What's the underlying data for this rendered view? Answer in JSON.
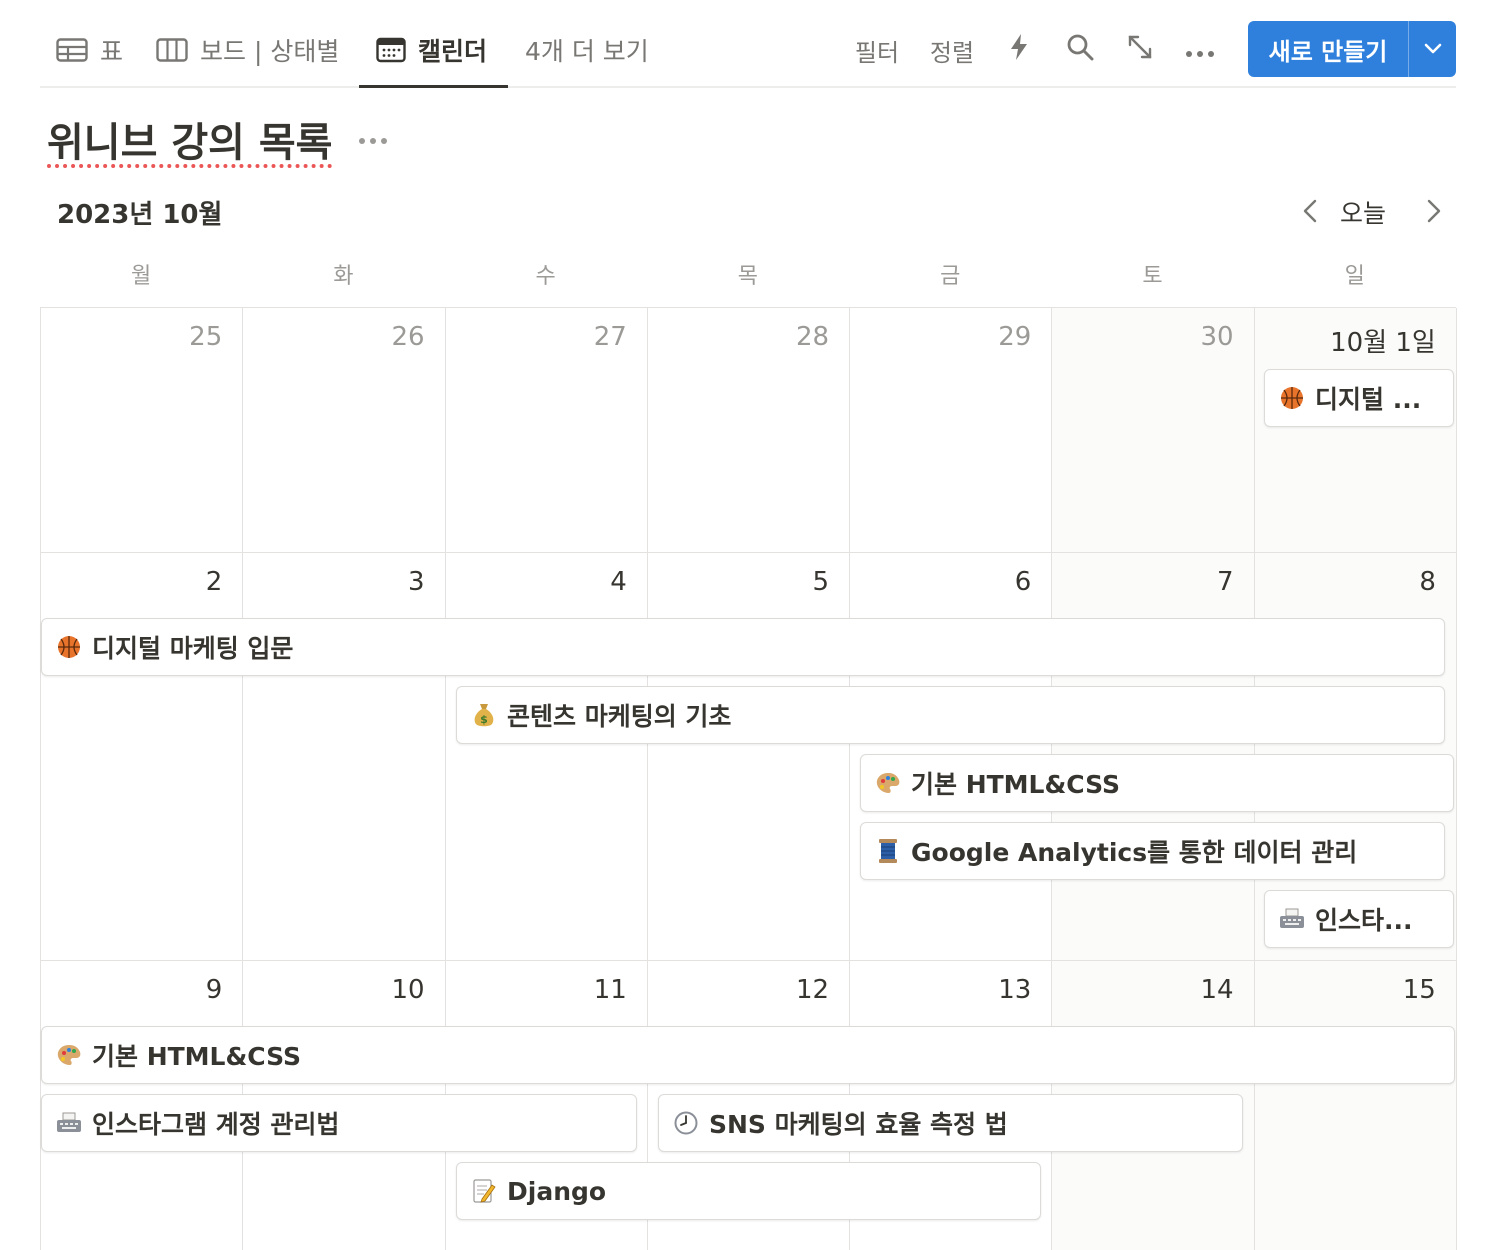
{
  "toolbar": {
    "views": [
      {
        "label": "표",
        "icon": "table-icon"
      },
      {
        "label": "보드 | 상태별",
        "icon": "board-icon"
      },
      {
        "label": "캘린더",
        "icon": "calendar-icon",
        "active": true
      },
      {
        "label": "4개 더 보기"
      }
    ],
    "filter_label": "필터",
    "sort_label": "정렬",
    "automation_icon": "lightning-icon",
    "search_icon": "search-icon",
    "expand_icon": "expand-icon",
    "more_icon": "more-icon",
    "new_button_label": "새로 만들기",
    "new_button_color": "#2f80dd"
  },
  "database": {
    "title": "위니브 강의 목록"
  },
  "calendar": {
    "month_label": "2023년 10월",
    "today_label": "오늘",
    "weekdays": [
      "월",
      "화",
      "수",
      "목",
      "금",
      "토",
      "일"
    ],
    "weeks": [
      [
        "25",
        "26",
        "27",
        "28",
        "29",
        "30",
        "10월 1일"
      ],
      [
        "2",
        "3",
        "4",
        "5",
        "6",
        "7",
        "8"
      ],
      [
        "9",
        "10",
        "11",
        "12",
        "13",
        "14",
        "15"
      ]
    ],
    "events": {
      "e1": {
        "emoji": "basketball",
        "title": "디지털 ..."
      },
      "e2": {
        "emoji": "basketball",
        "title": "디지털 마케팅 입문"
      },
      "e3": {
        "emoji": "money-bag",
        "title": "콘텐츠 마케팅의 기초"
      },
      "e4": {
        "emoji": "palette",
        "title": "기본 HTML&CSS"
      },
      "e5": {
        "emoji": "thread-spool",
        "title": "Google Analytics를 통한 데이터 관리"
      },
      "e6": {
        "emoji": "typewriter",
        "title": "인스타..."
      },
      "e7": {
        "emoji": "palette",
        "title": "기본 HTML&CSS"
      },
      "e8": {
        "emoji": "typewriter",
        "title": "인스타그램 계정 관리법"
      },
      "e9": {
        "emoji": "clock",
        "title": "SNS 마케팅의 효율 측정 법"
      },
      "e10": {
        "emoji": "memo",
        "title": "Django"
      }
    }
  }
}
